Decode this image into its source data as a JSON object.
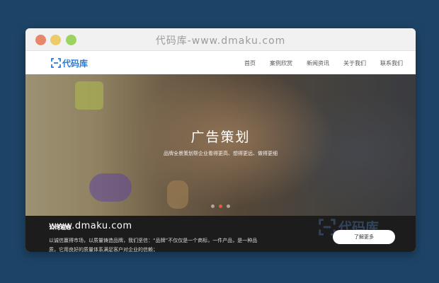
{
  "window": {
    "title": "代码库-www.dmaku.com"
  },
  "brand": {
    "logo_text": "代码库",
    "accent_color": "#2a7ad6",
    "logo_icon": "bracket-logo-icon"
  },
  "nav": {
    "items": [
      {
        "label": "首页"
      },
      {
        "label": "案例欣赏"
      },
      {
        "label": "新闻资讯"
      },
      {
        "label": "关于我们"
      },
      {
        "label": "联系我们"
      }
    ]
  },
  "hero": {
    "headline": "广告策划",
    "subline": "品牌全景策划帮企业看得更高、想得更远、做得更细",
    "slides_total": 3,
    "active_slide": 2
  },
  "about": {
    "watermark": "www.dmaku.com",
    "title": "公司理念",
    "text": "以诚信赢得市场，以质量铸造品牌，我们坚信：“品牌”不仅仅是一个商标，一件产品，是一种品质，它用良好的质量体系满足客户对企业的信赖；",
    "button_label": "了解更多",
    "logo_watermark_text": "代码库"
  }
}
